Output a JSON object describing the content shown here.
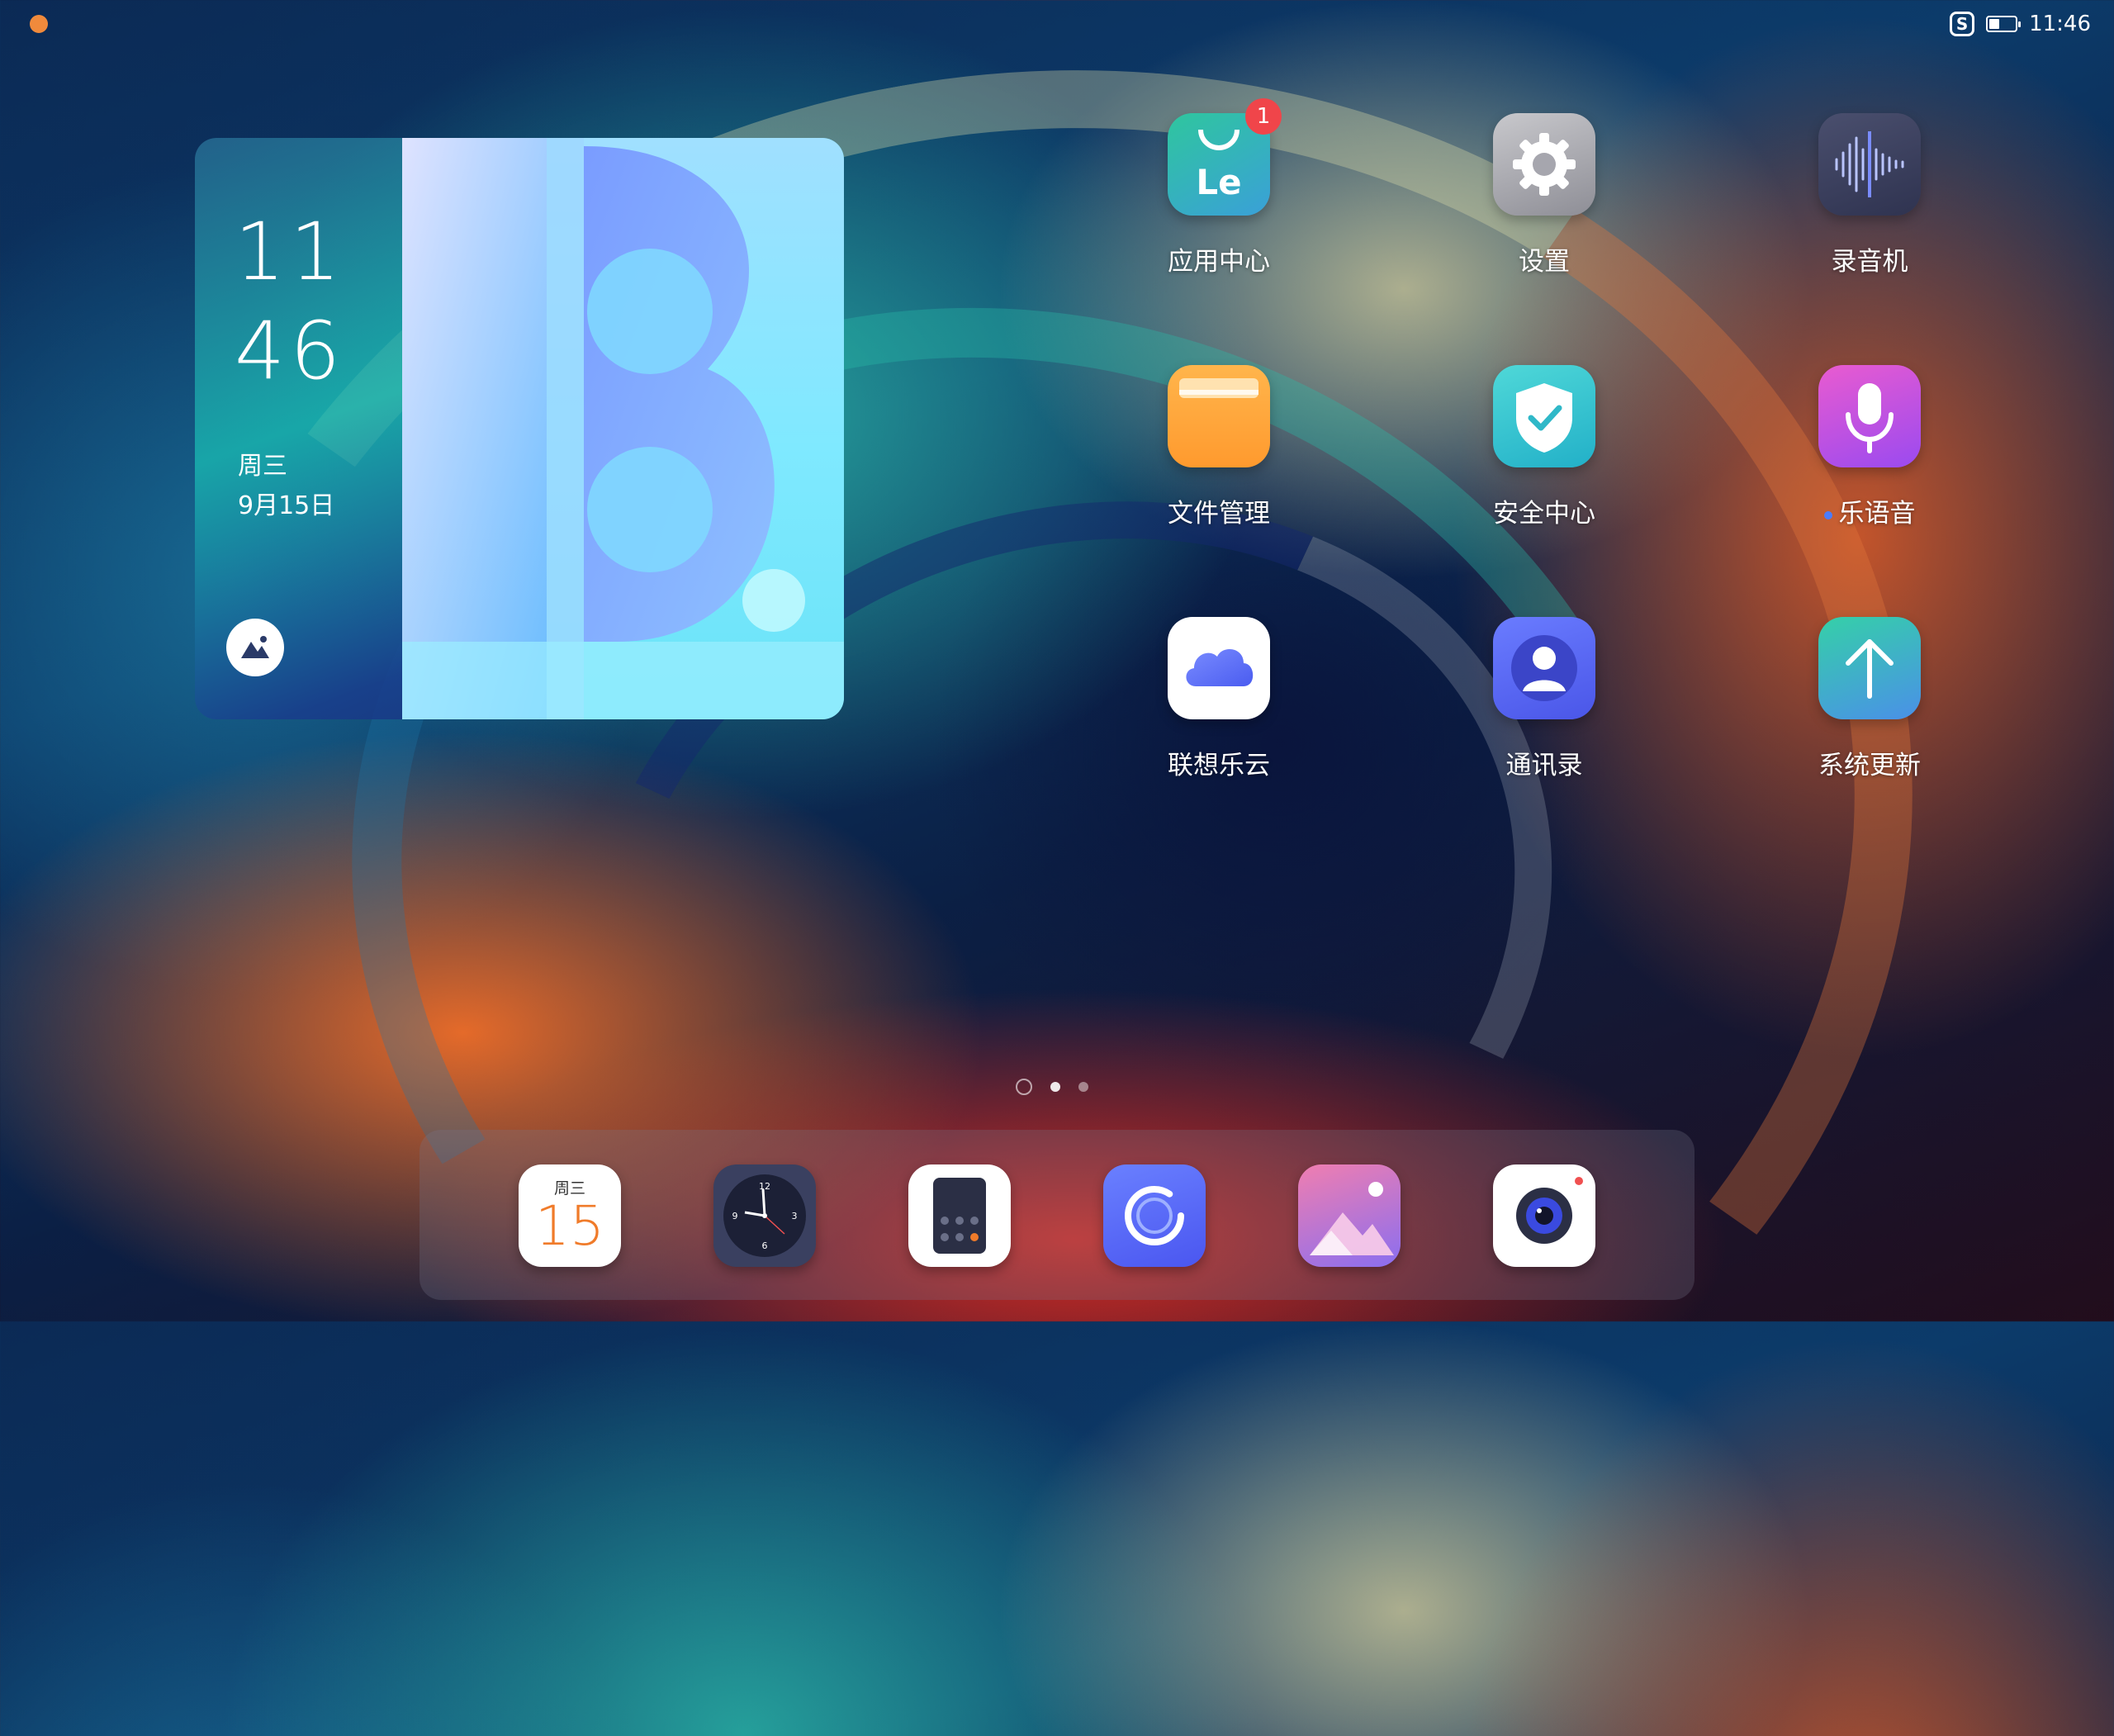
{
  "status_bar": {
    "time": "11:46",
    "sync_icon_letter": "S",
    "battery_level": 0.4
  },
  "widget": {
    "hours": "11",
    "minutes": "46",
    "day": "周三",
    "date": "9月15日"
  },
  "apps": [
    {
      "name": "app-center",
      "label": "应用中心",
      "badge": "1",
      "icon": "le-icon"
    },
    {
      "name": "settings",
      "label": "设置",
      "icon": "gear-icon"
    },
    {
      "name": "recorder",
      "label": "录音机",
      "icon": "waveform-icon"
    },
    {
      "name": "file-manager",
      "label": "文件管理",
      "icon": "folder-icon"
    },
    {
      "name": "security-center",
      "label": "安全中心",
      "icon": "shield-check-icon"
    },
    {
      "name": "le-voice",
      "label": "乐语音",
      "icon": "microphone-icon"
    },
    {
      "name": "lenovo-cloud",
      "label": "联想乐云",
      "icon": "cloud-icon"
    },
    {
      "name": "contacts",
      "label": "通讯录",
      "icon": "person-icon"
    },
    {
      "name": "system-update",
      "label": "系统更新",
      "icon": "arrow-up-icon"
    }
  ],
  "dock": {
    "calendar": {
      "day": "周三",
      "date": "15"
    },
    "clock_numerals": [
      "12",
      "3",
      "6",
      "9"
    ],
    "items": [
      "calendar-icon",
      "clock-icon",
      "calculator-icon",
      "browser-icon",
      "gallery-icon",
      "camera-icon"
    ]
  },
  "page_indicator": {
    "pages": 3,
    "current": 2
  },
  "colors": {
    "badge": "#f0454a",
    "calendar_accent": "#f07b2a"
  }
}
